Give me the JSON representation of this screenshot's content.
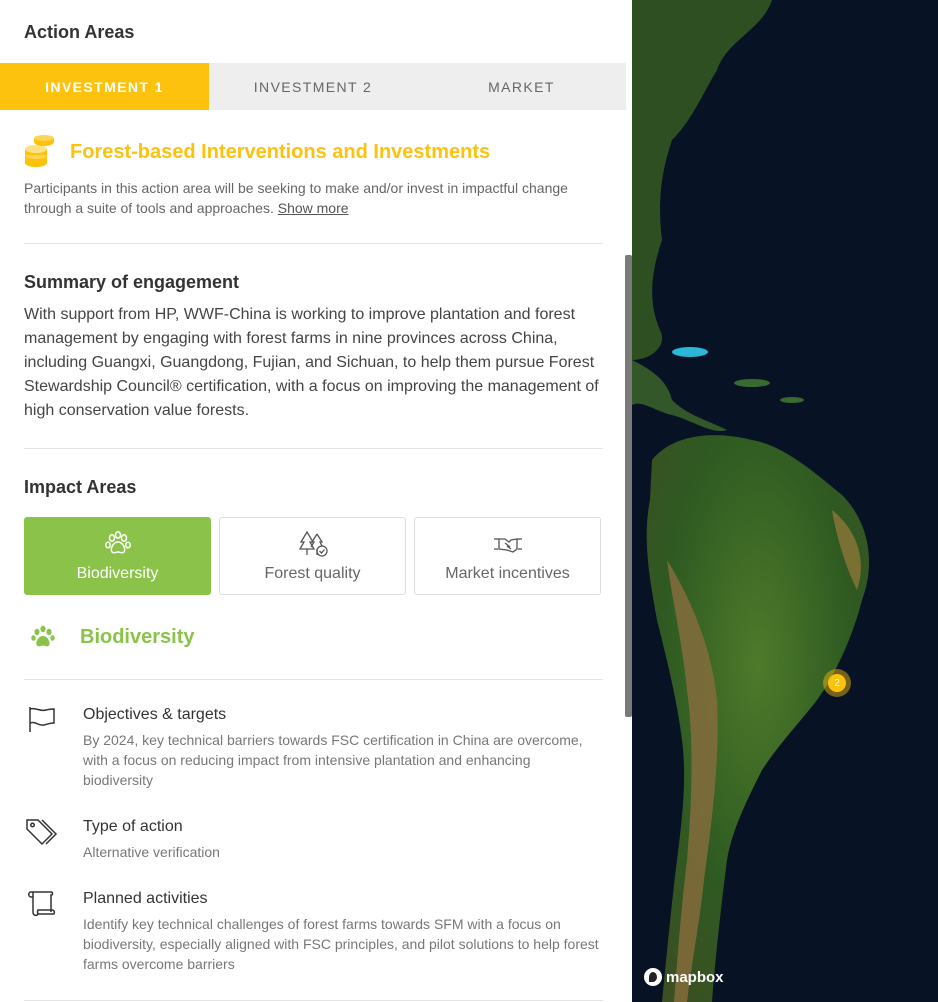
{
  "panel": {
    "heading": "Action Areas",
    "tabs": [
      {
        "label": "INVESTMENT 1",
        "active": true
      },
      {
        "label": "INVESTMENT 2",
        "active": false
      },
      {
        "label": "MARKET",
        "active": false
      }
    ]
  },
  "action_area": {
    "icon": "coins-icon",
    "title": "Forest-based Interventions and Investments",
    "intro": "Participants in this action area will be seeking to make and/or invest in impactful change through a suite of tools and approaches.",
    "show_more": "Show more"
  },
  "summary": {
    "heading": "Summary of engagement",
    "text": "With support from HP, WWF-China is working to improve plantation and forest management by engaging with forest farms in nine provinces across China, including Guangxi, Guangdong, Fujian, and Sichuan, to help them pursue Forest Stewardship Council® certification, with a focus on improving the management of high conservation value forests."
  },
  "impact": {
    "heading": "Impact Areas",
    "cards": [
      {
        "label": "Biodiversity",
        "icon": "paw-icon",
        "active": true
      },
      {
        "label": "Forest quality",
        "icon": "trees-icon",
        "active": false
      },
      {
        "label": "Market incentives",
        "icon": "handshake-icon",
        "active": false
      }
    ],
    "selected_title": "Biodiversity"
  },
  "details": [
    {
      "icon": "flag-icon",
      "title": "Objectives & targets",
      "text": "By 2024, key technical barriers towards FSC certification in China are overcome, with a focus on reducing impact from intensive plantation and enhancing biodiversity"
    },
    {
      "icon": "tags-icon",
      "title": "Type of action",
      "text": "Alternative verification"
    },
    {
      "icon": "scroll-icon",
      "title": "Planned activities",
      "text": "Identify key technical challenges of forest farms towards SFM with a focus on biodiversity, especially aligned with FSC principles, and pilot solutions to help forest farms overcome barriers"
    }
  ],
  "map": {
    "cluster_count": "2",
    "attribution": "mapbox",
    "colors": {
      "accent": "#fdc20e",
      "green": "#8bc34a",
      "ocean": "#071324"
    }
  }
}
